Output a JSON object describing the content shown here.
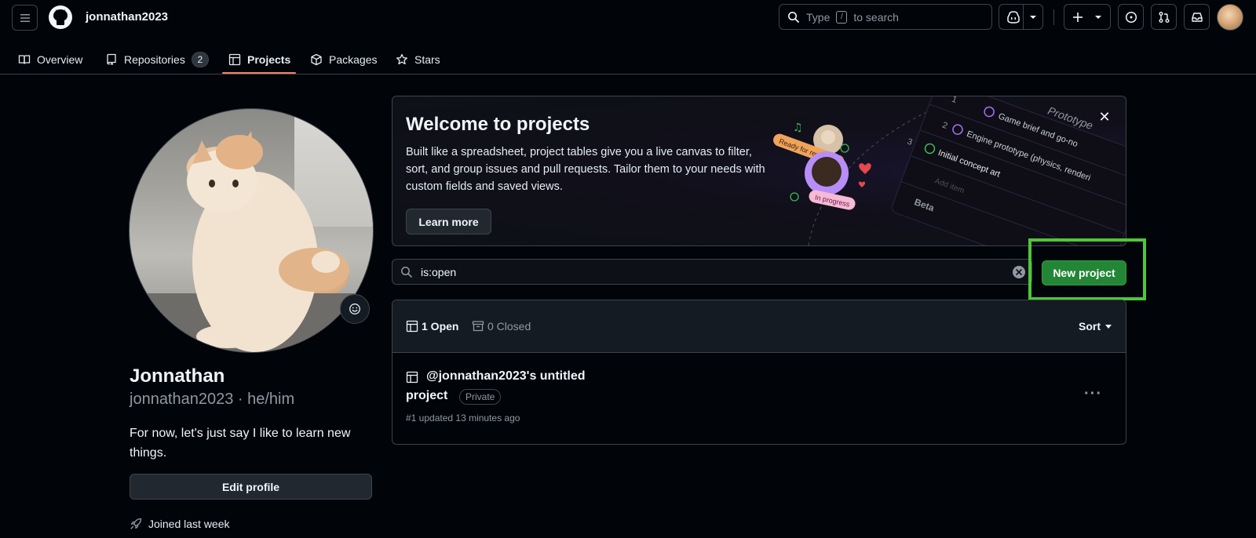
{
  "header": {
    "username": "jonnathan2023",
    "search": {
      "prefix": "Type",
      "key": "/",
      "suffix": "to search"
    }
  },
  "tabs": [
    {
      "label": "Overview",
      "icon": "book-icon"
    },
    {
      "label": "Repositories",
      "icon": "repo-icon",
      "count": "2"
    },
    {
      "label": "Projects",
      "icon": "table-icon",
      "active": true
    },
    {
      "label": "Packages",
      "icon": "package-icon"
    },
    {
      "label": "Stars",
      "icon": "star-icon"
    }
  ],
  "profile": {
    "display_name": "Jonnathan",
    "login_pronouns": "jonnathan2023 · he/him",
    "bio": "For now, let's just say I like to learn new things.",
    "edit_label": "Edit profile",
    "joined": "Joined last week"
  },
  "banner": {
    "title": "Welcome to projects",
    "text": "Built like a spreadsheet, project tables give you a live canvas to filter, sort, and group issues and pull requests. Tailor them to your needs with custom fields and saved views.",
    "learn_more": "Learn more",
    "illustration": {
      "prototype": "Prototype",
      "row2": "Game brief and go-no",
      "row3": "Engine prototype (physics, renderi",
      "row4": "Initial concept art",
      "add_item": "Add item",
      "beta": "Beta",
      "ready_badge": "Ready for review",
      "progress_badge": "In progress",
      "num1": "1",
      "num2": "2",
      "num3": "3"
    }
  },
  "filter": {
    "value": "is:open"
  },
  "new_project_label": "New project",
  "list": {
    "open_label": "1 Open",
    "closed_label": "0 Closed",
    "sort_label": "Sort",
    "projects": [
      {
        "title_line1": "@jonnathan2023's untitled",
        "title_line2": "project",
        "visibility": "Private",
        "meta": "#1 updated 13 minutes ago"
      }
    ]
  },
  "colors": {
    "accent_green": "#238636",
    "highlight": "#4ec73a",
    "tab_underline": "#f78166"
  }
}
